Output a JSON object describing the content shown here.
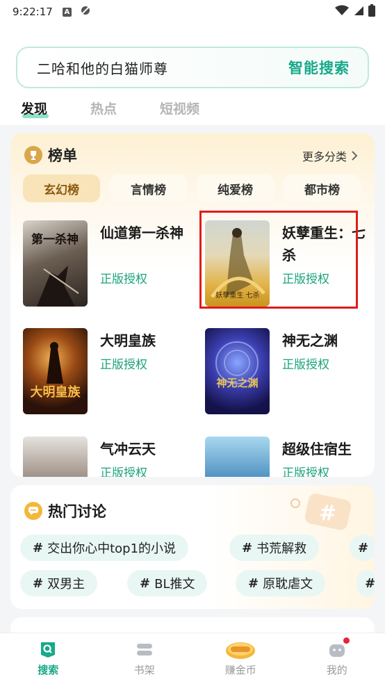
{
  "status_bar": {
    "time": "9:22:17",
    "notif_letter": "A"
  },
  "search": {
    "query": "二哈和他的白猫师尊",
    "button": "智能搜索"
  },
  "tabs": [
    "发现",
    "热点",
    "短视频"
  ],
  "ranking": {
    "title": "榜单",
    "more": "更多分类",
    "categories": [
      "玄幻榜",
      "言情榜",
      "纯爱榜",
      "都市榜"
    ],
    "books": [
      {
        "title": "仙道第一杀神",
        "tag": "正版授权",
        "cover_text": "第一杀神"
      },
      {
        "title": "妖孽重生：七杀",
        "tag": "正版授权",
        "cover_text": "妖孽重生 七杀"
      },
      {
        "title": "大明皇族",
        "tag": "正版授权",
        "cover_text": "大明皇族"
      },
      {
        "title": "神无之渊",
        "tag": "正版授权",
        "cover_text": "神无之渊"
      },
      {
        "title": "气冲云天",
        "tag": "正版授权",
        "cover_text": ""
      },
      {
        "title": "超级住宿生",
        "tag": "正版授权",
        "cover_text": ""
      }
    ]
  },
  "hot": {
    "title": "热门讨论",
    "topics": [
      "交出你心中top1的小说",
      "书荒解救",
      "双男主",
      "BL推文",
      "原耽虐文"
    ]
  },
  "nav": [
    "搜索",
    "书架",
    "赚金币",
    "我的"
  ],
  "colors": {
    "accent": "#18a98a",
    "highlight_border": "#e01b1b",
    "rank_bg": "#fdf1d3"
  }
}
